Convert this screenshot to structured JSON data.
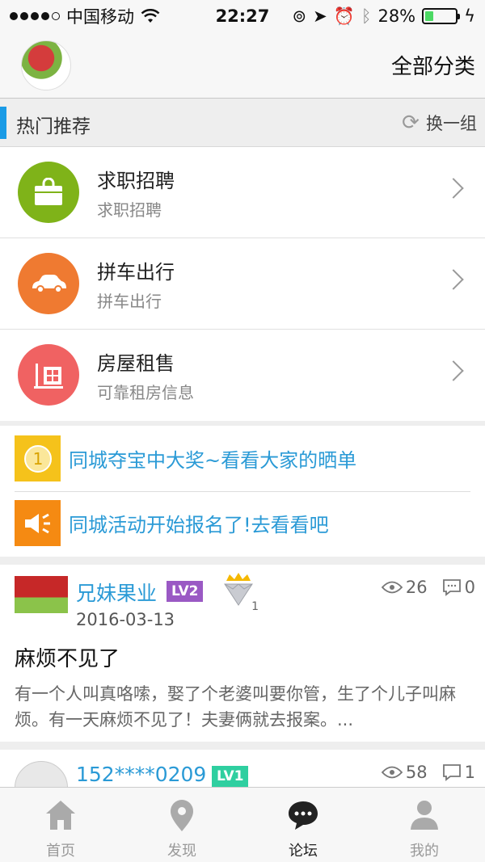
{
  "status_bar": {
    "carrier": "中国移动",
    "time": "22:27",
    "battery": "28%",
    "battery_level": 0.28
  },
  "header": {
    "title": "全部分类"
  },
  "hot": {
    "title": "热门推荐",
    "refresh_label": "换一组"
  },
  "categories": [
    {
      "title": "求职招聘",
      "subtitle": "求职招聘",
      "icon": "bag-icon",
      "color": "#7fb319"
    },
    {
      "title": "拼车出行",
      "subtitle": "拼车出行",
      "icon": "car-icon",
      "color": "#ef7a31"
    },
    {
      "title": "房屋租售",
      "subtitle": "可靠租房信息",
      "icon": "house-icon",
      "color": "#f06262"
    }
  ],
  "promos": [
    {
      "text": "同城夺宝中大奖~看看大家的晒单",
      "icon": "coin-icon",
      "color": "#f5c21b"
    },
    {
      "text": "同城活动开始报名了!去看看吧",
      "icon": "megaphone-icon",
      "color": "#f58a12"
    }
  ],
  "posts": [
    {
      "name": "兄妹果业",
      "level": "LV2",
      "level_color": "#9a59c4",
      "medal_count": "1",
      "date": "2016-03-13",
      "views": "26",
      "comments": "0",
      "title": "麻烦不见了",
      "excerpt": "有一个人叫真咯嗦，娶了个老婆叫要你管，生了个儿子叫麻烦。有一天麻烦不见了！夫妻俩就去报案。..."
    },
    {
      "name": "152****0209",
      "level": "LV1",
      "level_color": "#2fcfa0",
      "views": "58",
      "comments": "1"
    }
  ],
  "tabs": [
    {
      "label": "首页",
      "icon": "home-icon",
      "active": false
    },
    {
      "label": "发现",
      "icon": "discover-icon",
      "active": false
    },
    {
      "label": "论坛",
      "icon": "forum-icon",
      "active": true
    },
    {
      "label": "我的",
      "icon": "profile-icon",
      "active": false
    }
  ]
}
